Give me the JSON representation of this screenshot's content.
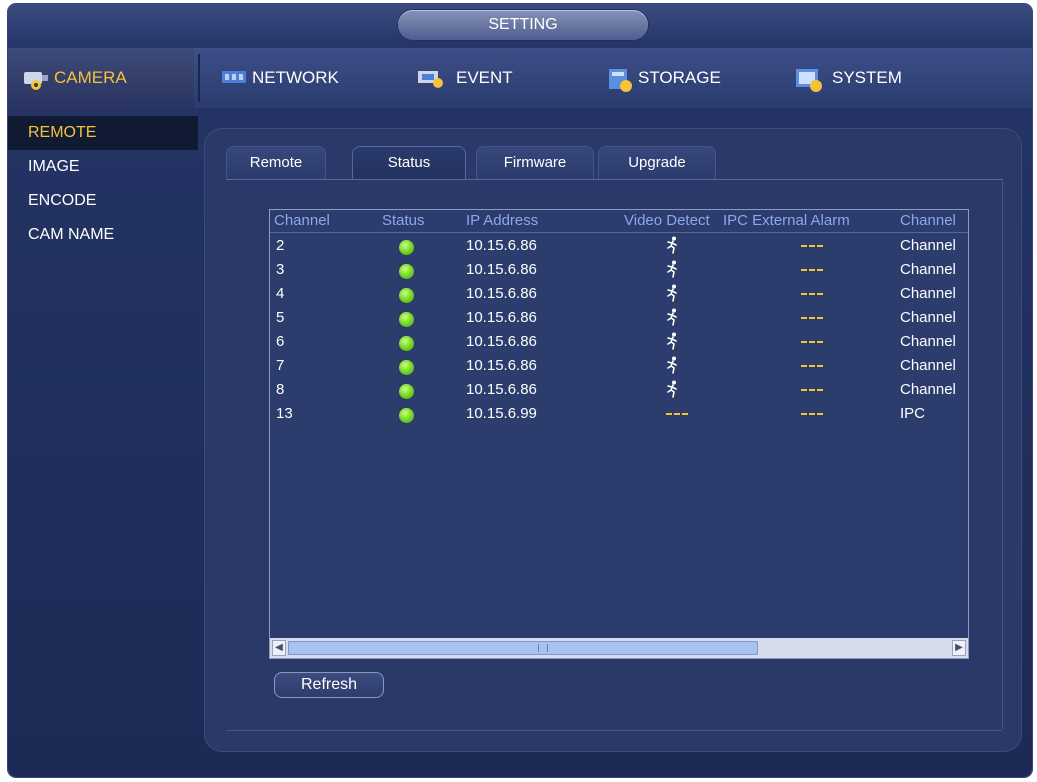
{
  "window": {
    "title": "SETTING"
  },
  "nav": [
    {
      "label": "CAMERA"
    },
    {
      "label": "NETWORK"
    },
    {
      "label": "EVENT"
    },
    {
      "label": "STORAGE"
    },
    {
      "label": "SYSTEM"
    }
  ],
  "sidebar": [
    {
      "label": "REMOTE"
    },
    {
      "label": "IMAGE"
    },
    {
      "label": "ENCODE"
    },
    {
      "label": "CAM NAME"
    }
  ],
  "tabs": [
    {
      "label": "Remote"
    },
    {
      "label": "Status"
    },
    {
      "label": "Firmware"
    },
    {
      "label": "Upgrade"
    }
  ],
  "table": {
    "headers": [
      "Channel",
      "Status",
      "IP Address",
      "Video Detect",
      "IPC External Alarm",
      "Channel"
    ],
    "rows": [
      {
        "channel": "2",
        "ip": "10.15.6.86",
        "last": "Channel"
      },
      {
        "channel": "3",
        "ip": "10.15.6.86",
        "last": "Channel"
      },
      {
        "channel": "4",
        "ip": "10.15.6.86",
        "last": "Channel"
      },
      {
        "channel": "5",
        "ip": "10.15.6.86",
        "last": "Channel"
      },
      {
        "channel": "6",
        "ip": "10.15.6.86",
        "last": "Channel"
      },
      {
        "channel": "7",
        "ip": "10.15.6.86",
        "last": "Channel"
      },
      {
        "channel": "8",
        "ip": "10.15.6.86",
        "last": "Channel"
      },
      {
        "channel": "13",
        "ip": "10.15.6.99",
        "last": "IPC"
      }
    ]
  },
  "buttons": {
    "refresh": "Refresh"
  },
  "colors": {
    "accent": "#f5c23a",
    "header_text": "#8ea6ee",
    "status_online": "#6fd320"
  }
}
